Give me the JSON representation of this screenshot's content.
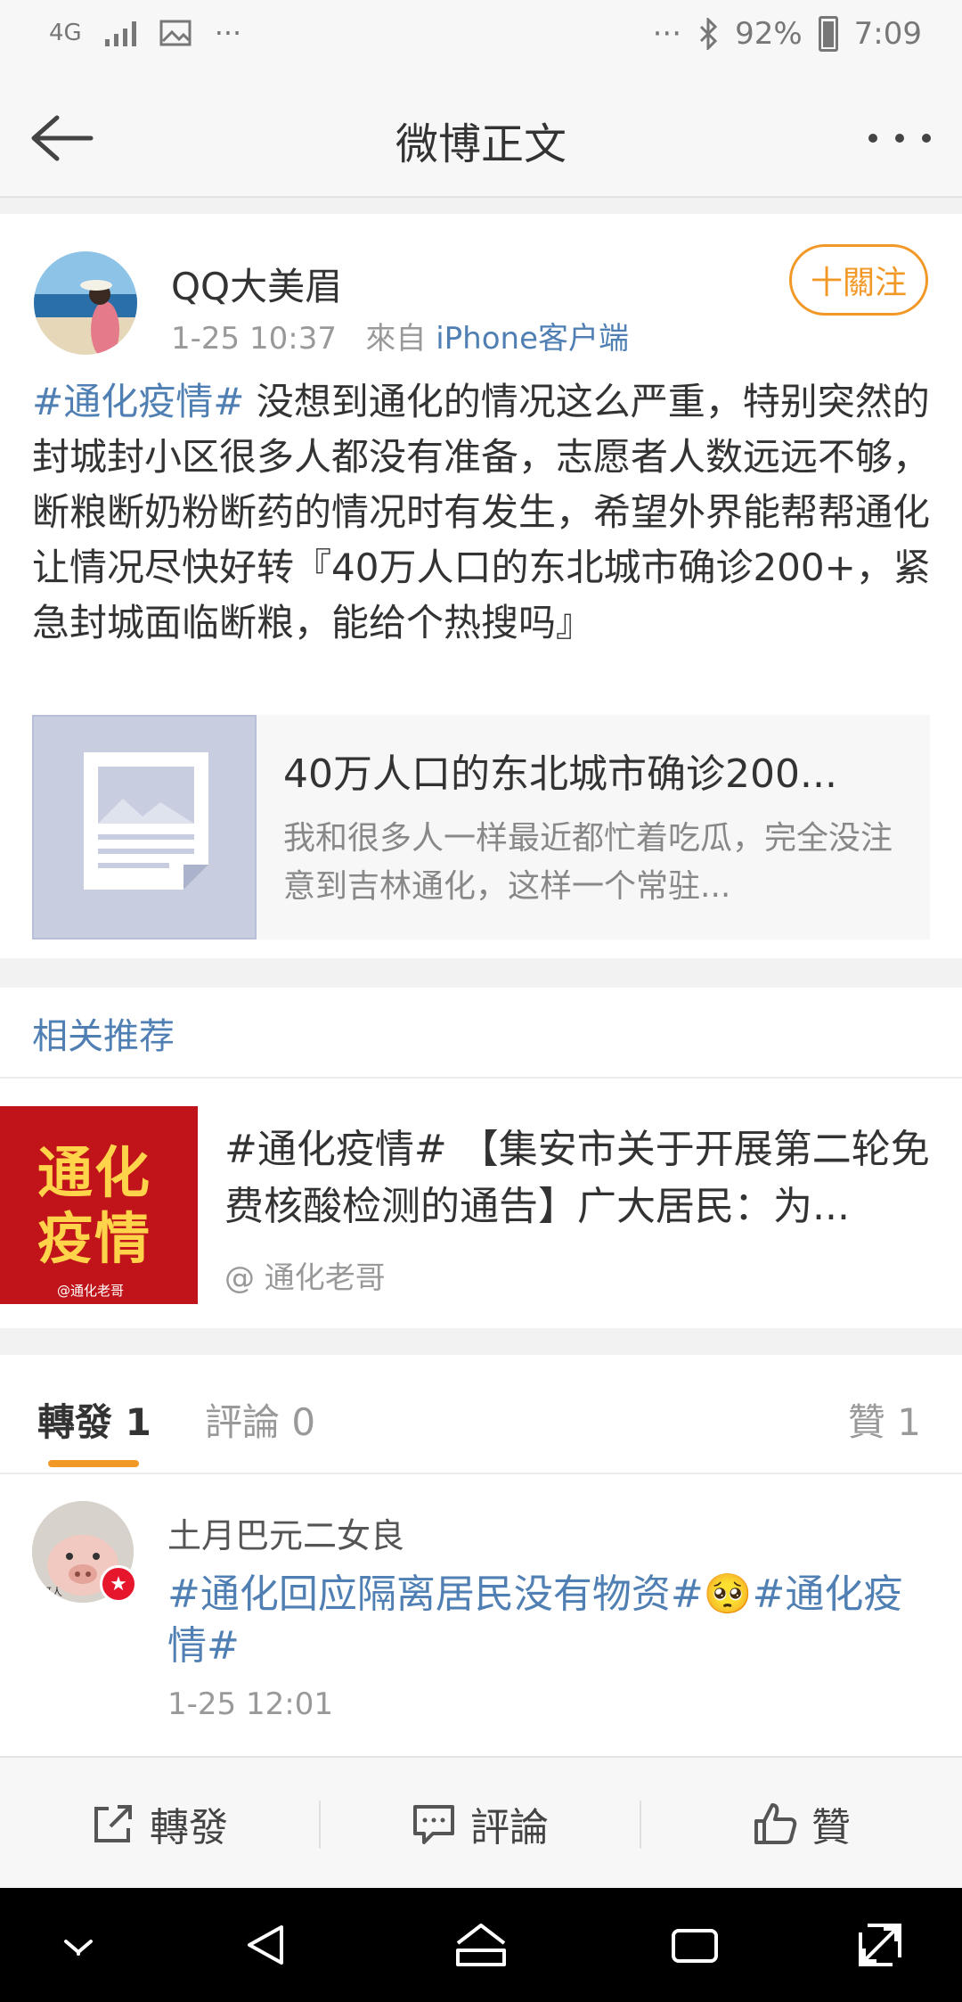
{
  "status_bar": {
    "network": "4G",
    "more_left": "···",
    "more_right": "···",
    "battery": "92%",
    "time": "7:09"
  },
  "nav": {
    "title": "微博正文"
  },
  "post": {
    "username": "QQ大美眉",
    "time": "1-25 10:37",
    "from_label": "來自",
    "source": "iPhone客户端",
    "follow_label": "十關注",
    "hashtag": "#通化疫情#",
    "text": " 没想到通化的情况这么严重，特别突然的封城封小区很多人都没有准备，志愿者人数远远不够，断粮断奶粉断药的情况时有发生，希望外界能帮帮通化让情况尽快好转『40万人口的东北城市确诊200+，紧急封城面临断粮，能给个热搜吗』",
    "link_card": {
      "title": "40万人口的东北城市确诊200...",
      "desc": "我和很多人一样最近都忙着吃瓜，完全没注意到吉林通化，这样一个常驻..."
    }
  },
  "related": {
    "heading": "相关推荐",
    "image_text_line1": "通化",
    "image_text_line2": "疫情",
    "image_watermark": "@通化老哥",
    "text": "#通化疫情# 【集安市关于开展第二轮免费核酸检测的通告】广大居民：为...",
    "author": "@ 通化老哥"
  },
  "tabs": {
    "repost_label": "轉發 1",
    "comment_label": "評論 0",
    "like_label": "贊 1"
  },
  "repost_item": {
    "name": "土月巴元二女良",
    "text_part1": "#通化回应隔离居民没有物资#",
    "emoji": "🥺",
    "text_part2": "#通化疫情#",
    "time": "1-25 12:01",
    "avatar_caption": "可人"
  },
  "action_bar": {
    "repost": "轉發",
    "comment": "評論",
    "like": "贊"
  },
  "colors": {
    "link_blue": "#4f7fb3",
    "accent_orange": "#f29827"
  }
}
